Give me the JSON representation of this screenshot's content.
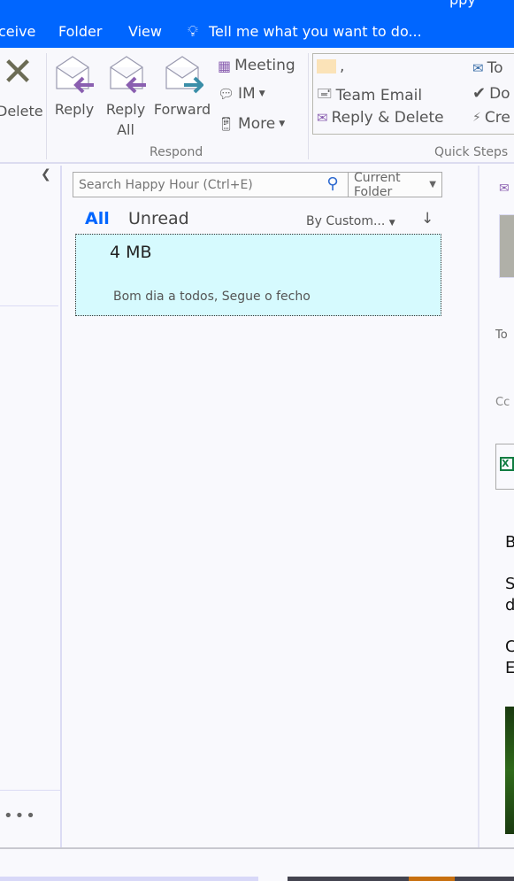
{
  "menu": {
    "tabs": [
      "ceive",
      "Folder",
      "View"
    ],
    "tell_me": "Tell me what you want to do...",
    "title_fragment": "ppy"
  },
  "ribbon": {
    "delete": "Delete",
    "reply": "Reply",
    "reply_all_1": "Reply",
    "reply_all_2": "All",
    "forward": "Forward",
    "meeting": "Meeting",
    "im": "IM",
    "more": "More",
    "respond_group": "Respond",
    "quick_steps": {
      "first": ",",
      "team_email": "Team Email",
      "reply_delete": "Reply & Delete",
      "to": "To",
      "done": "Do",
      "create": "Cre",
      "group": "Quick Steps"
    }
  },
  "search": {
    "placeholder": "Search Happy Hour (Ctrl+E)",
    "scope": "Current Folder"
  },
  "filters": {
    "all": "All",
    "unread": "Unread",
    "sort": "By Custom..."
  },
  "messages": [
    {
      "size": "4 MB",
      "preview": "Bom dia a todos,  Segue o fecho"
    }
  ],
  "reading": {
    "to": "To",
    "cc": "Cc",
    "body": [
      "B",
      "S",
      "d",
      "C",
      "E"
    ]
  },
  "colors": {
    "accent": "#0066ff",
    "selected": "#d6fafe"
  }
}
